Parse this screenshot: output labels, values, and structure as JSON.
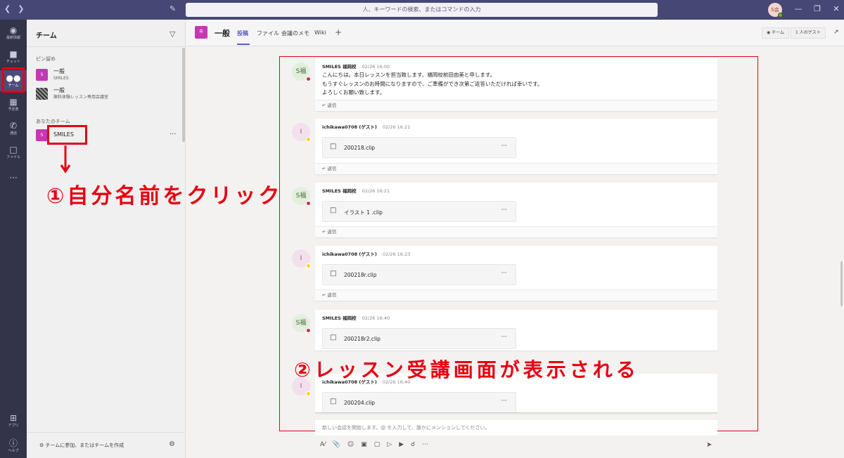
{
  "search": {
    "placeholder": "人、キーワードの検索、またはコマンドの入力"
  },
  "user": {
    "initials": "S会"
  },
  "rail": [
    {
      "label": "最新情報",
      "icon": "bell-icon",
      "glyph": "🔔"
    },
    {
      "label": "チャット",
      "icon": "chat-icon",
      "glyph": "💬"
    },
    {
      "label": "チーム",
      "icon": "teams-icon",
      "glyph": "👥"
    },
    {
      "label": "予定表",
      "icon": "calendar-icon",
      "glyph": "📅"
    },
    {
      "label": "通話",
      "icon": "phone-icon",
      "glyph": "📞"
    },
    {
      "label": "ファイル",
      "icon": "file-icon",
      "glyph": "📄"
    },
    {
      "label": "アプリ",
      "icon": "apps-icon",
      "glyph": "⊞"
    },
    {
      "label": "ヘルプ",
      "icon": "help-icon",
      "glyph": "?"
    }
  ],
  "teams_pane": {
    "title": "チーム",
    "pinned_label": "ピン留め",
    "pinned": [
      {
        "badge": "S",
        "name": "一般",
        "sub": "SMILES"
      },
      {
        "badge": "",
        "name": "一般",
        "sub": "無料体験レッスン専用会議室"
      }
    ],
    "your_teams_label": "あなたのチーム",
    "your_teams": [
      {
        "badge": "S",
        "name": "SMILES"
      }
    ],
    "join_label": "チームに参加、またはチームを作成"
  },
  "channel": {
    "badge": "市",
    "name": "一般",
    "tabs": [
      "投稿",
      "ファイル",
      "会議のメモ",
      "Wiki"
    ],
    "team_btn": "チーム",
    "guest_btn": "1 人のゲスト"
  },
  "posts": [
    {
      "avatar": "S福",
      "author": "SMILES 福岡校",
      "time": "02/26 16:00",
      "lines": [
        "こんにちは。本日レッスンを担当致します、福岡校前田由美と申します。",
        "もうすぐレッスンのお時間になりますので、ご準備ができ次第ご返答いただければ幸いです。",
        "よろしくお願い致します。"
      ]
    },
    {
      "avatar": "I",
      "author": "ichikawa0708 (ゲスト)",
      "time": "02/26 16:21",
      "file": "200218.clip"
    },
    {
      "avatar": "S福",
      "author": "SMILES 福岡校",
      "time": "02/26 16:21",
      "file": "イラスト 1 .clip"
    },
    {
      "avatar": "I",
      "author": "ichikawa0708 (ゲスト)",
      "time": "02/26 16:23",
      "file": "200218r.clip"
    },
    {
      "avatar": "S福",
      "author": "SMILES 福岡校",
      "time": "02/26 16:40",
      "file": "200218r2.clip"
    },
    {
      "avatar": "I",
      "author": "ichikawa0708 (ゲスト)",
      "time": "02/26 16:40",
      "file": "200204.clip"
    }
  ],
  "reply_label": "返信",
  "compose_placeholder": "新しい会話を開始します。@ を入力して、誰かにメンションしてください。",
  "annotations": {
    "step1": "①自分名前をクリック",
    "step2": "②レッスン受講画面が表示される"
  },
  "colors": {
    "accent": "#5b5fc7",
    "annotation": "#e60012",
    "titlebar": "#464775",
    "rail": "#33344a"
  }
}
